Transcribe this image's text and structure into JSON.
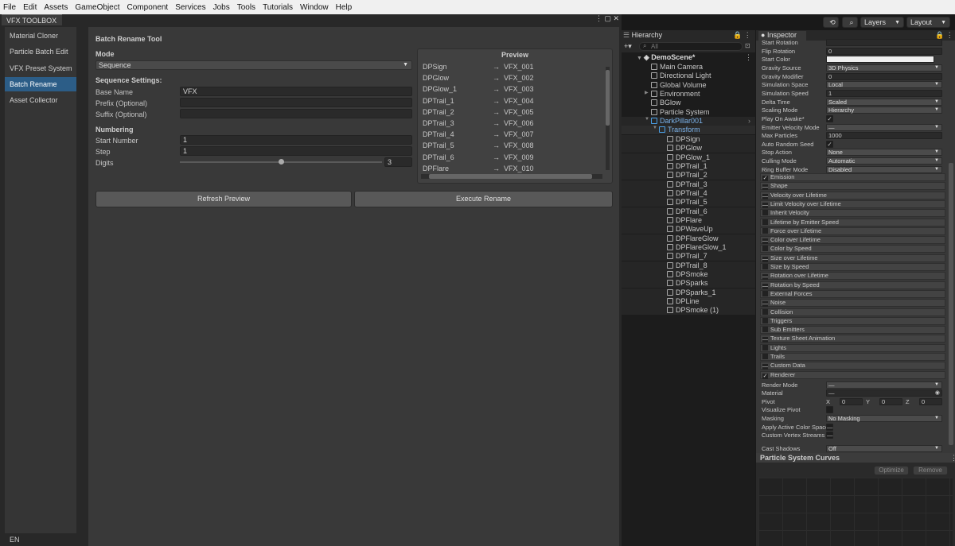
{
  "menubar": [
    "File",
    "Edit",
    "Assets",
    "GameObject",
    "Component",
    "Services",
    "Jobs",
    "Tools",
    "Tutorials",
    "Window",
    "Help"
  ],
  "toolbar": {
    "layers_label": "Layers",
    "layout_label": "Layout"
  },
  "window": {
    "tab_title": "VFX TOOLBOX",
    "status": "EN"
  },
  "sidebar": {
    "items": [
      {
        "label": "Material Cloner"
      },
      {
        "label": "Particle Batch Edit"
      },
      {
        "label": "VFX Preset System"
      },
      {
        "label": "Batch Rename"
      },
      {
        "label": "Asset Collector"
      }
    ],
    "active": "Batch Rename"
  },
  "tool": {
    "title": "Batch Rename Tool",
    "mode_label": "Mode",
    "mode_value": "Sequence",
    "seq_heading": "Sequence Settings:",
    "base_name_label": "Base Name",
    "base_name_value": "VFX",
    "prefix_label": "Prefix (Optional)",
    "prefix_value": "",
    "suffix_label": "Suffix (Optional)",
    "suffix_value": "",
    "numbering_heading": "Numbering",
    "start_label": "Start Number",
    "start_value": "1",
    "step_label": "Step",
    "step_value": "1",
    "digits_label": "Digits",
    "digits_value": "3",
    "refresh_label": "Refresh Preview",
    "execute_label": "Execute Rename"
  },
  "preview": {
    "title": "Preview",
    "arrow": "→",
    "rows": [
      {
        "from": "DPSign",
        "to": "VFX_001"
      },
      {
        "from": "DPGlow",
        "to": "VFX_002"
      },
      {
        "from": "DPGlow_1",
        "to": "VFX_003"
      },
      {
        "from": "DPTrail_1",
        "to": "VFX_004"
      },
      {
        "from": "DPTrail_2",
        "to": "VFX_005"
      },
      {
        "from": "DPTrail_3",
        "to": "VFX_006"
      },
      {
        "from": "DPTrail_4",
        "to": "VFX_007"
      },
      {
        "from": "DPTrail_5",
        "to": "VFX_008"
      },
      {
        "from": "DPTrail_6",
        "to": "VFX_009"
      },
      {
        "from": "DPFlare",
        "to": "VFX_010"
      }
    ]
  },
  "hierarchy": {
    "tab": "Hierarchy",
    "search_placeholder": "All",
    "scene": "DemoScene*",
    "items": [
      {
        "label": "Main Camera",
        "indent": 1
      },
      {
        "label": "Directional Light",
        "indent": 1
      },
      {
        "label": "Global Volume",
        "indent": 1
      },
      {
        "label": "Environment",
        "indent": 1
      },
      {
        "label": "BGlow",
        "indent": 1
      },
      {
        "label": "Particle System",
        "indent": 1
      },
      {
        "label": "DarkPillar001",
        "indent": 1,
        "highlight": true
      },
      {
        "label": "Transform",
        "indent": 2,
        "highlight": true
      },
      {
        "label": "DPSign",
        "indent": 3
      },
      {
        "label": "DPGlow",
        "indent": 3
      },
      {
        "label": "DPGlow_1",
        "indent": 3
      },
      {
        "label": "DPTrail_1",
        "indent": 3
      },
      {
        "label": "DPTrail_2",
        "indent": 3
      },
      {
        "label": "DPTrail_3",
        "indent": 3
      },
      {
        "label": "DPTrail_4",
        "indent": 3
      },
      {
        "label": "DPTrail_5",
        "indent": 3
      },
      {
        "label": "DPTrail_6",
        "indent": 3
      },
      {
        "label": "DPFlare",
        "indent": 3
      },
      {
        "label": "DPWaveUp",
        "indent": 3
      },
      {
        "label": "DPFlareGlow",
        "indent": 3
      },
      {
        "label": "DPFlareGlow_1",
        "indent": 3
      },
      {
        "label": "DPTrail_7",
        "indent": 3
      },
      {
        "label": "DPTrail_8",
        "indent": 3
      },
      {
        "label": "DPSmoke",
        "indent": 3
      },
      {
        "label": "DPSparks",
        "indent": 3
      },
      {
        "label": "DPSparks_1",
        "indent": 3
      },
      {
        "label": "DPLine",
        "indent": 3
      },
      {
        "label": "DPSmoke (1)",
        "indent": 3
      }
    ]
  },
  "inspector": {
    "tab": "Inspector",
    "props": [
      {
        "label": "Start Rotation",
        "value": "",
        "kind": "field"
      },
      {
        "label": "Flip Rotation",
        "value": "0",
        "kind": "field"
      },
      {
        "label": "Start Color",
        "value": "",
        "kind": "color"
      },
      {
        "label": "Gravity Source",
        "value": "3D Physics",
        "kind": "dropdown"
      },
      {
        "label": "Gravity Modifier",
        "value": "0",
        "kind": "field"
      },
      {
        "label": "Simulation Space",
        "value": "Local",
        "kind": "dropdown"
      },
      {
        "label": "Simulation Speed",
        "value": "1",
        "kind": "field"
      },
      {
        "label": "Delta Time",
        "value": "Scaled",
        "kind": "dropdown"
      },
      {
        "label": "Scaling Mode",
        "value": "Hierarchy",
        "kind": "dropdown"
      },
      {
        "label": "Play On Awake*",
        "value": "✓",
        "kind": "check"
      },
      {
        "label": "Emitter Velocity Mode",
        "value": "—",
        "kind": "dropdown"
      },
      {
        "label": "Max Particles",
        "value": "1000",
        "kind": "field"
      },
      {
        "label": "Auto Random Seed",
        "value": "✓",
        "kind": "check"
      },
      {
        "label": "Stop Action",
        "value": "None",
        "kind": "dropdown"
      },
      {
        "label": "Culling Mode",
        "value": "Automatic",
        "kind": "dropdown"
      },
      {
        "label": "Ring Buffer Mode",
        "value": "Disabled",
        "kind": "dropdown"
      }
    ],
    "modules": [
      {
        "label": "Emission",
        "mark": "✓"
      },
      {
        "label": "Shape",
        "mark": "—"
      },
      {
        "label": "Velocity over Lifetime",
        "mark": "—"
      },
      {
        "label": "Limit Velocity over Lifetime",
        "mark": "—"
      },
      {
        "label": "Inherit Velocity",
        "mark": ""
      },
      {
        "label": "Lifetime by Emitter Speed",
        "mark": ""
      },
      {
        "label": "Force over Lifetime",
        "mark": ""
      },
      {
        "label": "Color over Lifetime",
        "mark": "—"
      },
      {
        "label": "Color by Speed",
        "mark": ""
      },
      {
        "label": "Size over Lifetime",
        "mark": "—"
      },
      {
        "label": "Size by Speed",
        "mark": ""
      },
      {
        "label": "Rotation over Lifetime",
        "mark": "—"
      },
      {
        "label": "Rotation by Speed",
        "mark": "—"
      },
      {
        "label": "External Forces",
        "mark": ""
      },
      {
        "label": "Noise",
        "mark": "—"
      },
      {
        "label": "Collision",
        "mark": ""
      },
      {
        "label": "Triggers",
        "mark": ""
      },
      {
        "label": "Sub Emitters",
        "mark": ""
      },
      {
        "label": "Texture Sheet Animation",
        "mark": "—"
      },
      {
        "label": "Lights",
        "mark": ""
      },
      {
        "label": "Trails",
        "mark": ""
      },
      {
        "label": "Custom Data",
        "mark": "—"
      },
      {
        "label": "Renderer",
        "mark": "✓"
      }
    ],
    "renderer": [
      {
        "label": "Render Mode",
        "value": "—",
        "kind": "dropdown"
      },
      {
        "label": "Material",
        "value": "—",
        "kind": "field"
      },
      {
        "label": "Pivot",
        "value": "",
        "kind": "xyz"
      },
      {
        "label": "Visualize Pivot",
        "value": "",
        "kind": "check"
      },
      {
        "label": "Masking",
        "value": "No Masking",
        "kind": "dropdown"
      },
      {
        "label": "Apply Active Color Space",
        "value": "—",
        "kind": "check"
      },
      {
        "label": "Custom Vertex Streams",
        "value": "—",
        "kind": "check"
      },
      {
        "label": "Cast Shadows",
        "value": "Off",
        "kind": "dropdown"
      }
    ],
    "pivot": {
      "x": "0",
      "y": "0",
      "z": "0"
    },
    "curves_title": "Particle System Curves",
    "optimize_label": "Optimize",
    "remove_label": "Remove"
  }
}
